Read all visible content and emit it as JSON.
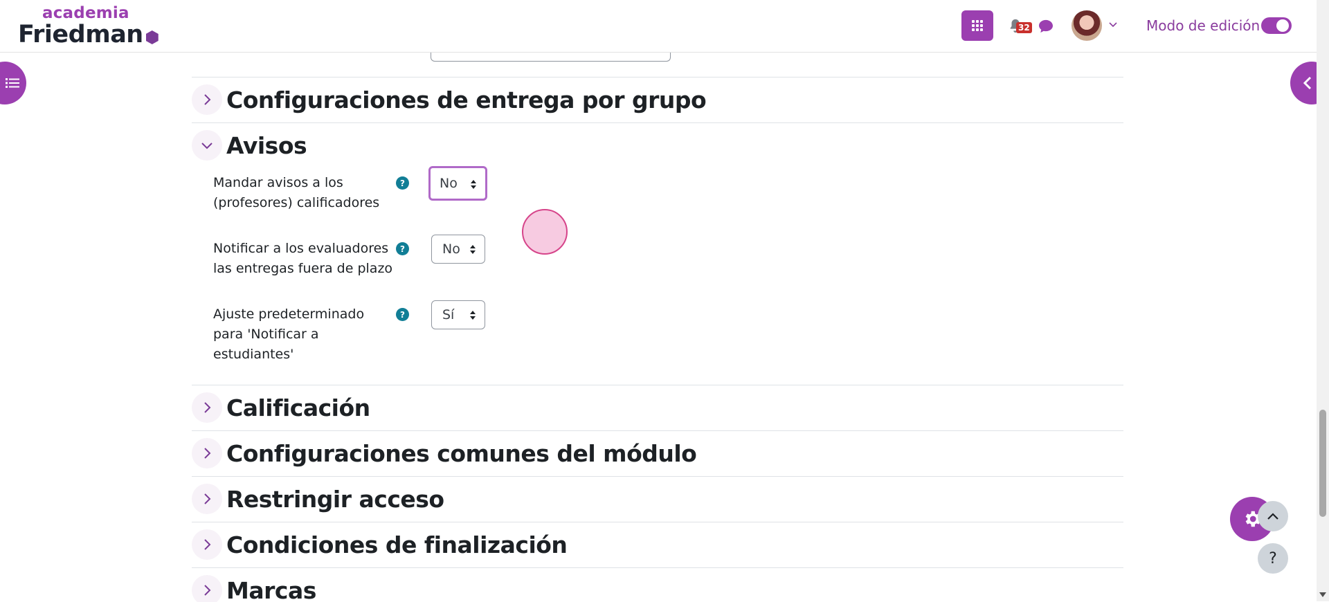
{
  "header": {
    "logo_top": "academia",
    "logo_bottom": "Friedman",
    "notification_count": "32",
    "edit_mode_label": "Modo de edición",
    "edit_mode_on": true
  },
  "sections": {
    "group_submission": "Configuraciones de entrega por grupo",
    "notices": "Avisos",
    "grade": "Calificación",
    "common_module": "Configuraciones comunes del módulo",
    "restrict_access": "Restringir acceso",
    "completion": "Condiciones de finalización",
    "tags": "Marcas"
  },
  "notices_fields": {
    "send_notices_label": "Mandar avisos a los (profesores) calificadores",
    "send_notices_value": "No",
    "late_notify_label": "Notificar a los evaluadores las entregas fuera de plazo",
    "late_notify_value": "No",
    "default_notify_label": "Ajuste predeterminado para 'Notificar a estudiantes'",
    "default_notify_value": "Sí"
  },
  "footer_buttons": {
    "help": "?"
  },
  "colors": {
    "accent": "#9b3fb0",
    "help_icon": "#117e96",
    "badge": "#c9302c"
  }
}
